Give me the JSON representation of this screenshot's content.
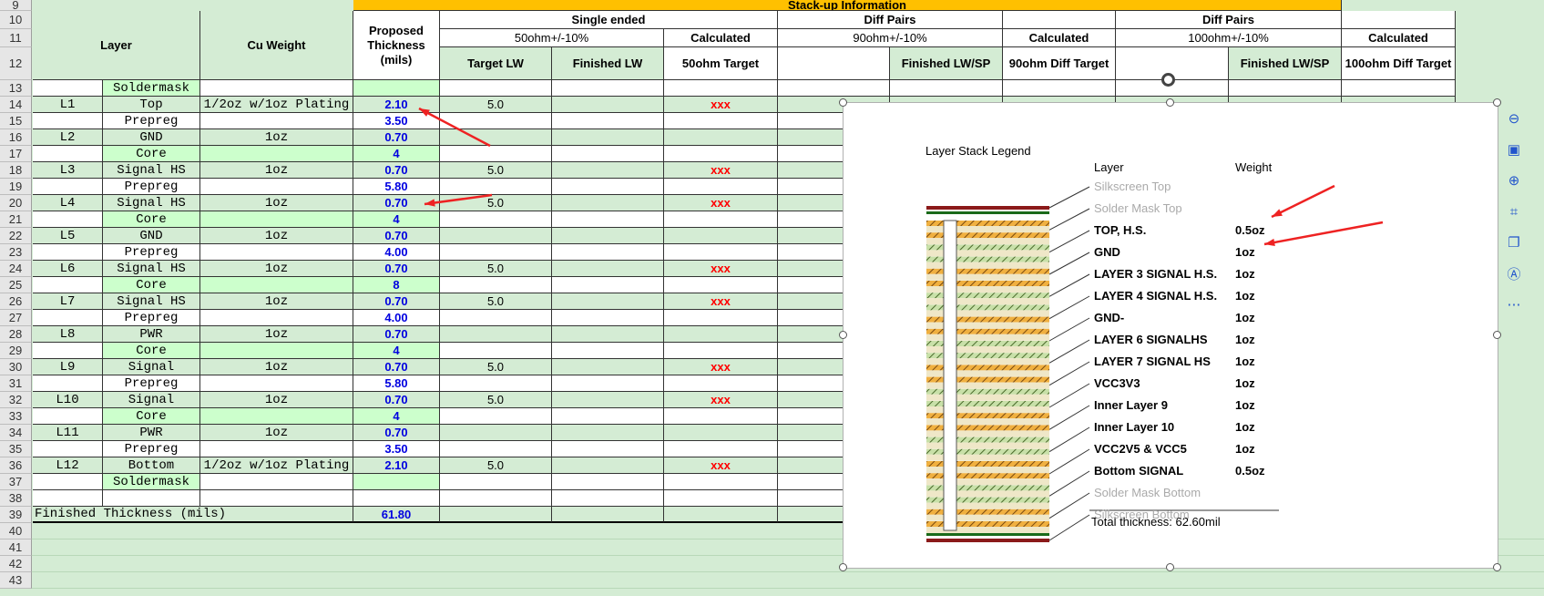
{
  "row_numbers": [
    "9",
    "10",
    "11",
    "12",
    "13",
    "14",
    "15",
    "16",
    "17",
    "18",
    "19",
    "20",
    "21",
    "22",
    "23",
    "24",
    "25",
    "26",
    "27",
    "28",
    "29",
    "30",
    "31",
    "32",
    "33",
    "34",
    "35",
    "36",
    "37",
    "38",
    "39",
    "40",
    "41",
    "42",
    "43"
  ],
  "headers": {
    "stackup_info": "Stack-up Information",
    "layer": "Layer",
    "cu_weight": "Cu Weight",
    "proposed_thickness": "Proposed Thickness (mils)",
    "single_ended": "Single ended",
    "se_impedance": "50ohm+/-10%",
    "target_lw": "Target LW",
    "finished_lw": "Finished LW",
    "calculated": "Calculated",
    "target_50": "50ohm Target",
    "diff_pairs": "Diff Pairs",
    "diff90_impedance": "90ohm+/-10%",
    "finished_lwsp": "Finished LW/SP",
    "target_90": "90ohm Diff Target",
    "diff100_impedance": "100ohm+/-10%",
    "target_100": "100ohm Diff Target"
  },
  "rows": [
    {
      "layer": "",
      "name": "Soldermask",
      "cu": "",
      "thk": "",
      "tlw": "",
      "calc": ""
    },
    {
      "layer": "L1",
      "name": "Top",
      "cu": "1/2oz w/1oz Plating",
      "thk": "2.10",
      "tlw": "5.0",
      "calc": "xxx"
    },
    {
      "layer": "",
      "name": "Prepreg",
      "cu": "",
      "thk": "3.50",
      "tlw": "",
      "calc": ""
    },
    {
      "layer": "L2",
      "name": "GND",
      "cu": "1oz",
      "thk": "0.70",
      "tlw": "",
      "calc": ""
    },
    {
      "layer": "",
      "name": "Core",
      "cu": "",
      "thk": "4",
      "tlw": "",
      "calc": ""
    },
    {
      "layer": "L3",
      "name": "Signal HS",
      "cu": "1oz",
      "thk": "0.70",
      "tlw": "5.0",
      "calc": "xxx"
    },
    {
      "layer": "",
      "name": "Prepreg",
      "cu": "",
      "thk": "5.80",
      "tlw": "",
      "calc": ""
    },
    {
      "layer": "L4",
      "name": "Signal HS",
      "cu": "1oz",
      "thk": "0.70",
      "tlw": "5.0",
      "calc": "xxx"
    },
    {
      "layer": "",
      "name": "Core",
      "cu": "",
      "thk": "4",
      "tlw": "",
      "calc": ""
    },
    {
      "layer": "L5",
      "name": "GND",
      "cu": "1oz",
      "thk": "0.70",
      "tlw": "",
      "calc": ""
    },
    {
      "layer": "",
      "name": "Prepreg",
      "cu": "",
      "thk": "4.00",
      "tlw": "",
      "calc": ""
    },
    {
      "layer": "L6",
      "name": "Signal HS",
      "cu": "1oz",
      "thk": "0.70",
      "tlw": "5.0",
      "calc": "xxx"
    },
    {
      "layer": "",
      "name": "Core",
      "cu": "",
      "thk": "8",
      "tlw": "",
      "calc": ""
    },
    {
      "layer": "L7",
      "name": "Signal HS",
      "cu": "1oz",
      "thk": "0.70",
      "tlw": "5.0",
      "calc": "xxx"
    },
    {
      "layer": "",
      "name": "Prepreg",
      "cu": "",
      "thk": "4.00",
      "tlw": "",
      "calc": ""
    },
    {
      "layer": "L8",
      "name": "PWR",
      "cu": "1oz",
      "thk": "0.70",
      "tlw": "",
      "calc": ""
    },
    {
      "layer": "",
      "name": "Core",
      "cu": "",
      "thk": "4",
      "tlw": "",
      "calc": ""
    },
    {
      "layer": "L9",
      "name": "Signal",
      "cu": "1oz",
      "thk": "0.70",
      "tlw": "5.0",
      "calc": "xxx"
    },
    {
      "layer": "",
      "name": "Prepreg",
      "cu": "",
      "thk": "5.80",
      "tlw": "",
      "calc": ""
    },
    {
      "layer": "L10",
      "name": "Signal",
      "cu": "1oz",
      "thk": "0.70",
      "tlw": "5.0",
      "calc": "xxx"
    },
    {
      "layer": "",
      "name": "Core",
      "cu": "",
      "thk": "4",
      "tlw": "",
      "calc": ""
    },
    {
      "layer": "L11",
      "name": "PWR",
      "cu": "1oz",
      "thk": "0.70",
      "tlw": "",
      "calc": ""
    },
    {
      "layer": "",
      "name": "Prepreg",
      "cu": "",
      "thk": "3.50",
      "tlw": "",
      "calc": ""
    },
    {
      "layer": "L12",
      "name": "Bottom",
      "cu": "1/2oz w/1oz Plating",
      "thk": "2.10",
      "tlw": "5.0",
      "calc": "xxx"
    },
    {
      "layer": "",
      "name": "Soldermask",
      "cu": "",
      "thk": "",
      "tlw": "",
      "calc": ""
    },
    {
      "layer": "",
      "name": "",
      "cu": "",
      "thk": "",
      "tlw": "",
      "calc": ""
    }
  ],
  "finished": {
    "label": "Finished Thickness (mils)",
    "value": "61.80"
  },
  "legend": {
    "title": "Layer Stack Legend",
    "col_layer": "Layer",
    "col_weight": "Weight",
    "items": [
      {
        "name": "Silkscreen Top",
        "weight": "",
        "style": "gray"
      },
      {
        "name": "Solder Mask Top",
        "weight": "",
        "style": "gray"
      },
      {
        "name": "TOP,   H.S.",
        "weight": "0.5oz",
        "style": "bold"
      },
      {
        "name": "GND",
        "weight": "1oz",
        "style": "bold"
      },
      {
        "name": "LAYER 3 SIGNAL H.S.",
        "weight": "1oz",
        "style": "bold"
      },
      {
        "name": "LAYER 4 SIGNAL H.S.",
        "weight": "1oz",
        "style": "bold"
      },
      {
        "name": "GND-",
        "weight": "1oz",
        "style": "bold"
      },
      {
        "name": "LAYER 6 SIGNALHS",
        "weight": "1oz",
        "style": "bold"
      },
      {
        "name": "LAYER 7 SIGNAL HS",
        "weight": "1oz",
        "style": "bold"
      },
      {
        "name": "VCC3V3",
        "weight": "1oz",
        "style": "bold"
      },
      {
        "name": "Inner Layer 9",
        "weight": "1oz",
        "style": "bold"
      },
      {
        "name": "Inner Layer 10",
        "weight": "1oz",
        "style": "bold"
      },
      {
        "name": "VCC2V5    &    VCC5",
        "weight": "1oz",
        "style": "bold"
      },
      {
        "name": "Bottom  SIGNAL",
        "weight": "0.5oz",
        "style": "bold"
      },
      {
        "name": "Solder Mask Bottom",
        "weight": "",
        "style": "gray"
      },
      {
        "name": "Silkscreen Bottom",
        "weight": "",
        "style": "gray"
      }
    ],
    "total": "Total thickness: 62.60mil"
  },
  "toolbar": [
    {
      "icon": "minus-circle-icon",
      "glyph": "⊖"
    },
    {
      "icon": "chart-icon",
      "glyph": "▣"
    },
    {
      "icon": "zoom-in-icon",
      "glyph": "⊕"
    },
    {
      "icon": "crop-icon",
      "glyph": "⌗"
    },
    {
      "icon": "copy-icon",
      "glyph": "❐"
    },
    {
      "icon": "text-recognition-icon",
      "glyph": "Ⓐ"
    },
    {
      "icon": "more-icon",
      "glyph": "⋯"
    }
  ],
  "colors": {
    "header_yellow": "#ffc000",
    "value_blue": "#0000e0",
    "calc_red": "#ff0000",
    "arrow_red": "#ee2222"
  }
}
